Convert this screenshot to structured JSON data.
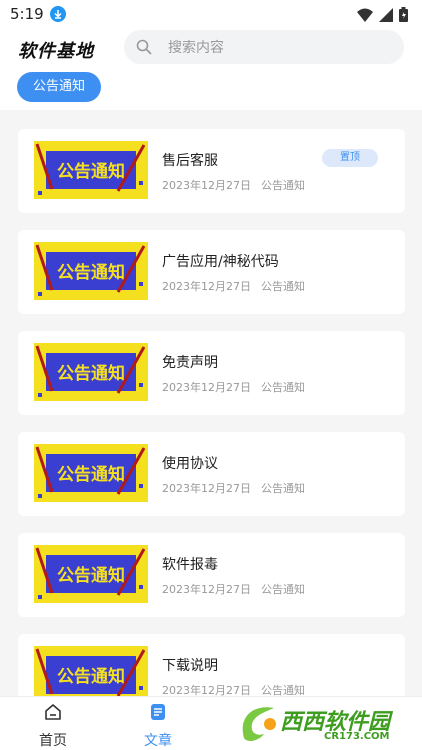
{
  "status_bar": {
    "time": "5:19"
  },
  "header": {
    "app_title": "软件基地",
    "search_placeholder": "搜索内容",
    "active_tab": "公告通知"
  },
  "thumbnail_text": "公告通知",
  "articles": [
    {
      "title": "售后客服",
      "date": "2023年12月27日",
      "category": "公告通知",
      "badge": "置顶"
    },
    {
      "title": "广告应用/神秘代码",
      "date": "2023年12月27日",
      "category": "公告通知"
    },
    {
      "title": "免责声明",
      "date": "2023年12月27日",
      "category": "公告通知"
    },
    {
      "title": "使用协议",
      "date": "2023年12月27日",
      "category": "公告通知"
    },
    {
      "title": "软件报毒",
      "date": "2023年12月27日",
      "category": "公告通知"
    },
    {
      "title": "下载说明",
      "date": "2023年12月27日",
      "category": "公告通知"
    }
  ],
  "bottom_nav": {
    "home": "首页",
    "articles": "文章"
  },
  "watermark": {
    "text": "西西软件园",
    "url": "CR173.COM"
  },
  "colors": {
    "accent": "#3d8ff2",
    "thumb_frame": "#f5e020",
    "thumb_inner": "#3a3fd1",
    "watermark": "#3d9d1f"
  }
}
